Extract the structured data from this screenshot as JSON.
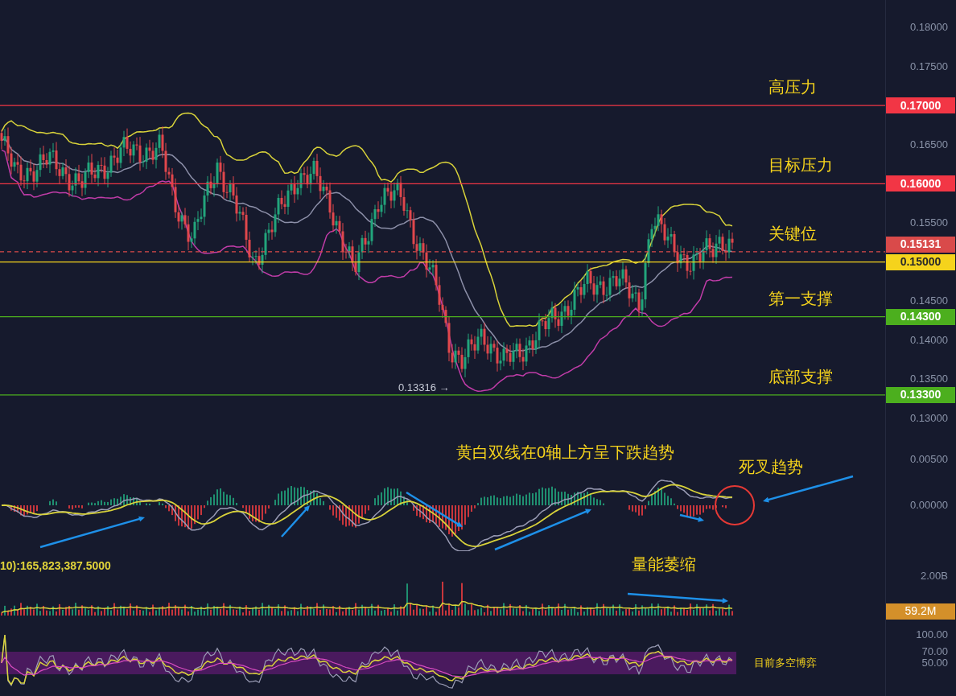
{
  "price_pane": {
    "axis_ticks": [
      "0.18000",
      "0.17500",
      "0.16500",
      "0.15500",
      "0.14500",
      "0.14000",
      "0.13500",
      "0.13000"
    ],
    "levels": [
      {
        "label": "0.17000",
        "color": "#f23645",
        "kind": "line",
        "annotation": "高压力"
      },
      {
        "label": "0.16000",
        "color": "#f23645",
        "kind": "line",
        "annotation": "目标压力"
      },
      {
        "label": "0.15131",
        "color": "#d94a4a",
        "kind": "current",
        "annotation": "关键位"
      },
      {
        "label": "0.15000",
        "color": "#f5d31c",
        "kind": "line"
      },
      {
        "label": "0.14300",
        "color": "#4caf1e",
        "kind": "line",
        "annotation": "第一支撑"
      },
      {
        "label": "0.13300",
        "color": "#4caf1e",
        "kind": "line",
        "annotation": "底部支撑"
      }
    ],
    "low_marker": "0.13316 →"
  },
  "macd_pane": {
    "axis_ticks": [
      "0.00500",
      "0.00000"
    ],
    "annotations": [
      "黄白双线在0轴上方呈下跌趋势",
      "死叉趋势"
    ]
  },
  "volume_pane": {
    "legend": "10):165,823,387.5000",
    "axis_ticks": [
      "2.00B"
    ],
    "last_volume": "59.2M",
    "annotation": "量能萎缩"
  },
  "rsi_pane": {
    "axis_ticks": [
      "100.00",
      "70.00",
      "50.00"
    ],
    "annotation": "目前多空博弈"
  }
}
